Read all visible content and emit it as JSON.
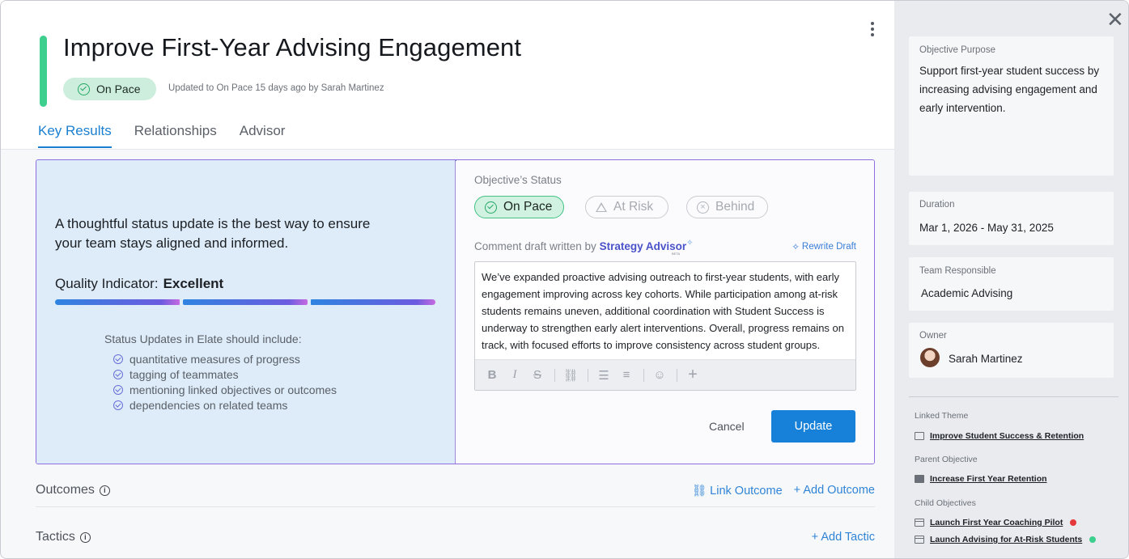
{
  "header": {
    "title": "Improve First-Year Advising Engagement",
    "status": "On Pace",
    "updated": "Updated to On Pace 15 days ago by Sarah Martinez"
  },
  "tabs": [
    "Key Results",
    "Relationships",
    "Advisor"
  ],
  "advisor_panel": {
    "tip": "A thoughtful status update is the best way to ensure your team stays aligned and informed.",
    "quality_label": "Quality Indicator:",
    "quality_value": "Excellent",
    "quality_level": 1.0,
    "include_heading": "Status Updates in Elate should include:",
    "include_items": [
      "quantitative measures of progress",
      "tagging of teammates",
      "mentioning linked objectives or outcomes",
      "dependencies on related teams"
    ]
  },
  "status_form": {
    "label": "Objective’s Status",
    "options": [
      "On Pace",
      "At Risk",
      "Behind"
    ],
    "selected": "On Pace",
    "draft_prefix": "Comment draft written by",
    "draft_brand": "Strategy Advisor",
    "draft_badge": "BETA",
    "rewrite_label": "Rewrite Draft",
    "comment": "We’ve expanded proactive advising outreach to first-year students, with early engagement improving across key cohorts. While participation among at-risk students remains uneven, additional coordination with Student Success is underway to strengthen early alert interventions. Overall, progress remains on track, with focused efforts to improve consistency across student groups.",
    "toolbar": {
      "bold": "B",
      "italic": "I",
      "strike": "S",
      "link": "🔗",
      "bullets": "☰",
      "numbered": "≡",
      "emoji": "☺",
      "add": "+"
    },
    "cancel_label": "Cancel",
    "update_label": "Update"
  },
  "outcomes": {
    "title": "Outcomes",
    "link_label": "Link Outcome",
    "add_label": "+ Add Outcome"
  },
  "tactics": {
    "title": "Tactics",
    "add_label": "+ Add Tactic"
  },
  "sidebar": {
    "purpose_label": "Objective Purpose",
    "purpose_lines": [
      "Support first-year student success by",
      "increasing advising engagement and",
      "early intervention."
    ],
    "duration_label": "Duration",
    "duration": "Mar 1, 2026 - May 31, 2025",
    "team_label": "Team Responsible",
    "team": "Academic Advising",
    "owner_label": "Owner",
    "owner": "Sarah Martinez",
    "linked_theme_label": "Linked Theme",
    "linked_theme": "Improve Student Success & Retention",
    "parent_label": "Parent Objective",
    "parent": "Increase First Year Retention",
    "children_label": "Child Objectives",
    "children": [
      {
        "name": "Launch First Year Coaching Pilot",
        "status_color": "#e5383b"
      },
      {
        "name": "Launch Advising for At-Risk Students",
        "status_color": "#3ccf8e"
      }
    ]
  },
  "colors": {
    "accent": "#1780d8",
    "on_pace": "#3ccf8e",
    "brand": "#4a52c9"
  }
}
